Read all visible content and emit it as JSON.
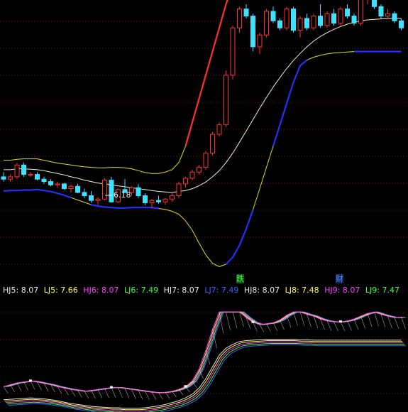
{
  "colors": {
    "background": "#000000",
    "grid": "#8a1010",
    "up": "#ff3030",
    "down": "#40e0ff",
    "band_mid": "#f0f0d0",
    "band_low": "#2030ff",
    "band_high": "#e0e000",
    "hj": "#ff40ff",
    "lj": "#60ff60"
  },
  "main_panel": {
    "annotation_low": "6.18",
    "signal_labels": [
      {
        "text": "跌",
        "color": "#40ff40",
        "bg": "#105010"
      },
      {
        "text": "财",
        "color": "#40a0ff",
        "bg": "#102050"
      }
    ]
  },
  "legend": [
    {
      "label": "HJ5: 8.07",
      "color": "#e8e8e8"
    },
    {
      "label": "LJ5: 7.66",
      "color": "#ffff40"
    },
    {
      "label": "HJ6: 8.07",
      "color": "#ff40ff"
    },
    {
      "label": "LJ6: 7.49",
      "color": "#40ff40"
    },
    {
      "label": "HJ7: 8.07",
      "color": "#e8e8e8"
    },
    {
      "label": "LJ7: 7.49",
      "color": "#4060ff"
    },
    {
      "label": "HJ8: 8.07",
      "color": "#e8e8e8"
    },
    {
      "label": "LJ8: 7.48",
      "color": "#ffff40"
    },
    {
      "label": "HJ9: 8.07",
      "color": "#ff40ff"
    },
    {
      "label": "LJ9: 7.47",
      "color": "#40ff40"
    }
  ],
  "chart_data": {
    "type": "candlestick",
    "ohlc": [
      [
        6.95,
        7.05,
        6.85,
        6.9
      ],
      [
        6.9,
        7.0,
        6.85,
        6.95
      ],
      [
        6.95,
        7.25,
        6.9,
        7.2
      ],
      [
        7.2,
        7.25,
        6.95,
        7.0
      ],
      [
        7.0,
        7.05,
        6.95,
        7.0
      ],
      [
        7.0,
        7.05,
        6.88,
        6.9
      ],
      [
        6.9,
        6.95,
        6.8,
        6.85
      ],
      [
        6.85,
        6.9,
        6.75,
        6.78
      ],
      [
        6.78,
        6.85,
        6.72,
        6.8
      ],
      [
        6.8,
        6.82,
        6.68,
        6.7
      ],
      [
        6.7,
        6.78,
        6.62,
        6.75
      ],
      [
        6.75,
        6.8,
        6.6,
        6.62
      ],
      [
        6.62,
        6.7,
        6.5,
        6.55
      ],
      [
        6.55,
        6.65,
        6.4,
        6.45
      ],
      [
        6.45,
        6.52,
        6.35,
        6.48
      ],
      [
        6.48,
        6.92,
        6.45,
        6.88
      ],
      [
        6.88,
        6.95,
        6.4,
        6.42
      ],
      [
        6.42,
        6.7,
        6.4,
        6.68
      ],
      [
        6.68,
        6.9,
        6.6,
        6.62
      ],
      [
        6.62,
        6.75,
        6.55,
        6.72
      ],
      [
        6.72,
        6.8,
        6.5,
        6.55
      ],
      [
        6.55,
        6.6,
        6.35,
        6.4
      ],
      [
        6.4,
        6.48,
        6.28,
        6.45
      ],
      [
        6.45,
        6.55,
        6.38,
        6.42
      ],
      [
        6.42,
        6.5,
        6.36,
        6.48
      ],
      [
        6.48,
        6.6,
        6.42,
        6.55
      ],
      [
        6.55,
        6.85,
        6.5,
        6.8
      ],
      [
        6.8,
        6.95,
        6.72,
        6.92
      ],
      [
        6.92,
        7.1,
        6.88,
        7.05
      ],
      [
        7.05,
        7.2,
        7.0,
        7.15
      ],
      [
        7.15,
        7.5,
        7.1,
        7.45
      ],
      [
        7.45,
        7.9,
        7.4,
        7.85
      ],
      [
        7.85,
        8.1,
        7.8,
        8.05
      ],
      [
        8.05,
        9.2,
        8.0,
        9.1
      ],
      [
        9.1,
        10.15,
        9.0,
        10.1
      ],
      [
        10.1,
        10.55,
        10.0,
        10.5
      ],
      [
        10.5,
        10.6,
        10.3,
        10.35
      ],
      [
        10.35,
        10.4,
        9.6,
        9.7
      ],
      [
        9.7,
        10.0,
        9.55,
        9.95
      ],
      [
        9.95,
        10.5,
        9.9,
        10.45
      ],
      [
        10.45,
        10.55,
        10.2,
        10.25
      ],
      [
        10.25,
        10.3,
        10.05,
        10.1
      ],
      [
        10.1,
        10.55,
        10.05,
        10.5
      ],
      [
        10.5,
        10.55,
        10.0,
        10.05
      ],
      [
        10.05,
        10.35,
        9.9,
        10.3
      ],
      [
        10.3,
        10.4,
        10.05,
        10.1
      ],
      [
        10.1,
        10.4,
        10.05,
        10.35
      ],
      [
        10.35,
        10.6,
        10.1,
        10.15
      ],
      [
        10.15,
        10.45,
        10.1,
        10.4
      ],
      [
        10.4,
        10.5,
        10.15,
        10.2
      ],
      [
        10.2,
        10.55,
        10.15,
        10.5
      ],
      [
        10.5,
        10.6,
        10.3,
        10.35
      ],
      [
        10.35,
        10.4,
        10.15,
        10.2
      ],
      [
        10.2,
        10.75,
        10.15,
        10.7
      ],
      [
        10.7,
        10.85,
        10.6,
        10.8
      ],
      [
        10.8,
        10.85,
        10.5,
        10.55
      ],
      [
        10.55,
        10.6,
        10.3,
        10.35
      ],
      [
        10.35,
        10.5,
        10.28,
        10.4
      ],
      [
        10.4,
        10.45,
        10.2,
        10.25
      ],
      [
        10.25,
        10.3,
        10.05,
        10.1
      ]
    ],
    "bands": {
      "mid": [
        7.1,
        7.1,
        7.12,
        7.12,
        7.11,
        7.1,
        7.08,
        7.05,
        7.02,
        6.99,
        6.95,
        6.92,
        6.88,
        6.85,
        6.82,
        6.8,
        6.78,
        6.76,
        6.74,
        6.72,
        6.7,
        6.68,
        6.66,
        6.64,
        6.63,
        6.62,
        6.64,
        6.66,
        6.7,
        6.76,
        6.84,
        6.95,
        7.08,
        7.25,
        7.45,
        7.68,
        7.92,
        8.16,
        8.4,
        8.63,
        8.85,
        9.05,
        9.24,
        9.41,
        9.56,
        9.7,
        9.82,
        9.92,
        10.0,
        10.07,
        10.13,
        10.18,
        10.22,
        10.25,
        10.27,
        10.28,
        10.29,
        10.3,
        10.3,
        10.3
      ],
      "low": [
        6.65,
        6.66,
        6.66,
        6.67,
        6.67,
        6.68,
        6.66,
        6.64,
        6.6,
        6.56,
        6.51,
        6.46,
        6.41,
        6.36,
        6.33,
        6.31,
        6.3,
        6.29,
        6.29,
        6.3,
        6.3,
        6.3,
        6.3,
        6.28,
        6.26,
        6.22,
        6.16,
        6.02,
        5.82,
        5.55,
        5.3,
        5.12,
        5.05,
        5.1,
        5.25,
        5.5,
        5.85,
        6.25,
        6.7,
        7.15,
        7.6,
        8.05,
        8.5,
        8.95,
        9.3,
        9.42,
        9.48,
        9.52,
        9.55,
        9.57,
        9.58,
        9.59,
        9.6,
        9.6,
        9.6,
        9.6,
        9.6,
        9.6,
        9.6,
        9.6
      ],
      "high": [
        7.3,
        7.3,
        7.32,
        7.33,
        7.33,
        7.33,
        7.3,
        7.27,
        7.24,
        7.22,
        7.2,
        7.18,
        7.16,
        7.15,
        7.14,
        7.14,
        7.15,
        7.15,
        7.14,
        7.12,
        7.08,
        7.04,
        7.02,
        7.02,
        7.05,
        7.1,
        7.25,
        7.6,
        8.1,
        8.6,
        9.1,
        9.6,
        10.1,
        10.6,
        11.0,
        11.3,
        11.5,
        11.6,
        11.65,
        11.68,
        11.7,
        11.7,
        11.7,
        11.7,
        11.7,
        11.7,
        11.7,
        11.7,
        11.7,
        11.7,
        11.7,
        11.7,
        11.7,
        11.7,
        11.7,
        11.7,
        11.7,
        11.7,
        11.7,
        11.7
      ]
    },
    "ylim": [
      4.8,
      10.6
    ],
    "sub_ylim": [
      6.0,
      8.3
    ],
    "hj": [
      6.48,
      6.52,
      6.56,
      6.58,
      6.6,
      6.58,
      6.55,
      6.52,
      6.48,
      6.45,
      6.42,
      6.4,
      6.38,
      6.4,
      6.42,
      6.44,
      6.46,
      6.46,
      6.44,
      6.42,
      6.4,
      6.38,
      6.36,
      6.35,
      6.36,
      6.38,
      6.42,
      6.48,
      6.6,
      6.85,
      7.25,
      7.7,
      8.07,
      8.07,
      8.07,
      8.07,
      7.95,
      7.85,
      7.8,
      7.82,
      7.84,
      7.9,
      8.0,
      8.07,
      8.07,
      8.02,
      7.98,
      7.92,
      7.88,
      7.86,
      7.86,
      7.88,
      7.92,
      7.98,
      8.04,
      8.07,
      8.02,
      7.98,
      7.95,
      7.96
    ],
    "lj": [
      6.2,
      6.21,
      6.22,
      6.23,
      6.24,
      6.23,
      6.22,
      6.2,
      6.18,
      6.15,
      6.12,
      6.1,
      6.08,
      6.06,
      6.05,
      6.04,
      6.03,
      6.03,
      6.02,
      6.02,
      6.02,
      6.03,
      6.05,
      6.07,
      6.1,
      6.14,
      6.18,
      6.24,
      6.32,
      6.45,
      6.65,
      6.9,
      7.15,
      7.3,
      7.38,
      7.44,
      7.46,
      7.47,
      7.48,
      7.49,
      7.49,
      7.49,
      7.49,
      7.49,
      7.48,
      7.48,
      7.47,
      7.47,
      7.47,
      7.47,
      7.47,
      7.47,
      7.47,
      7.47,
      7.47,
      7.47,
      7.47,
      7.47,
      7.47,
      7.47
    ]
  }
}
